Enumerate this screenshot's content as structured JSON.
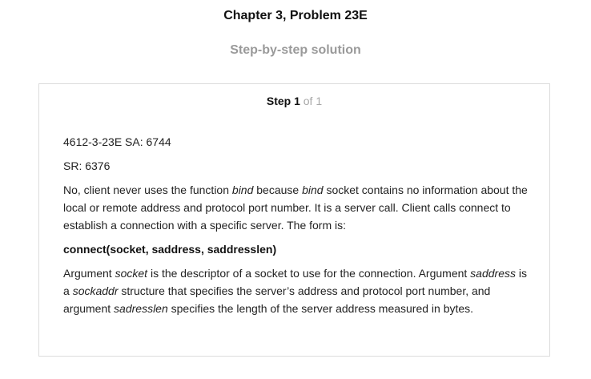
{
  "header": {
    "chapter_title": "Chapter 3, Problem 23E",
    "subtitle": "Step-by-step solution"
  },
  "step": {
    "label": "Step 1",
    "of_text": " of 1"
  },
  "content": {
    "line1": "4612-3-23E SA: 6744",
    "line2": "SR: 6376",
    "para1": {
      "t1": "No, client never uses the function ",
      "i1": "bind",
      "t2": " because ",
      "i2": "bind",
      "t3": " socket contains no information about the local or remote address and protocol port number. It is a server call. Client calls connect to establish a connection with a specific server. The form is:"
    },
    "formula": "connect(socket, saddress, saddresslen)",
    "para2": {
      "t1": "Argument ",
      "i1": "socket",
      "t2": " is the descriptor of a socket to use for the connection. Argument ",
      "i2": "saddress",
      "t3": " is a ",
      "i3": "sockaddr",
      "t4": " structure that specifies the server’s address and protocol port number, and argument ",
      "i4": "sadresslen",
      "t5": " specifies the length of the server address measured in bytes."
    }
  }
}
